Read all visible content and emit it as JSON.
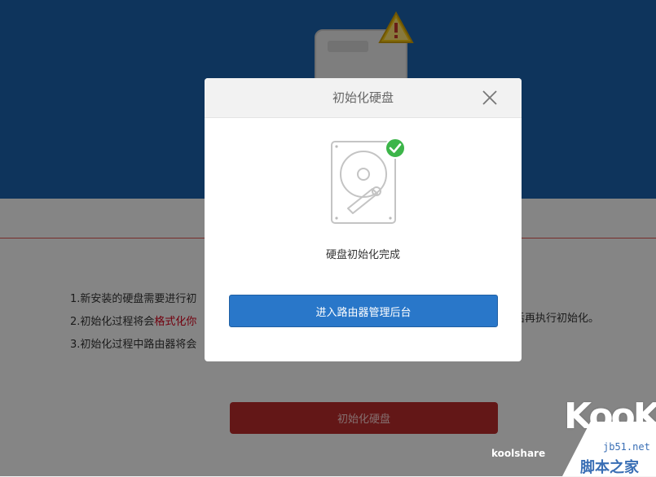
{
  "background": {
    "notes": [
      "1.新安装的硬盘需要进行初",
      "2.初始化过程将会",
      "3.初始化过程中路由器将会"
    ],
    "note2_highlight": "格式化你",
    "note2_tail": "后再执行初始化。",
    "init_button_label": "初始化硬盘",
    "colors": {
      "hero": "#1a5fa8",
      "init_button": "#b52a2a",
      "red_line": "#d9534f"
    }
  },
  "modal": {
    "title": "初始化硬盘",
    "close_icon": "close-icon",
    "drive_icon": "hard-drive-icon",
    "check_icon": "check-circle-icon",
    "status_text": "硬盘初始化完成",
    "enter_button_label": "进入路由器管理后台",
    "colors": {
      "enter_button": "#2977c9",
      "check": "#3cb549"
    }
  },
  "watermarks": {
    "kook": "KooK",
    "koolshare": "koolshare",
    "jb51_url": "jb51.net",
    "jb51_cn": "脚本之家"
  }
}
